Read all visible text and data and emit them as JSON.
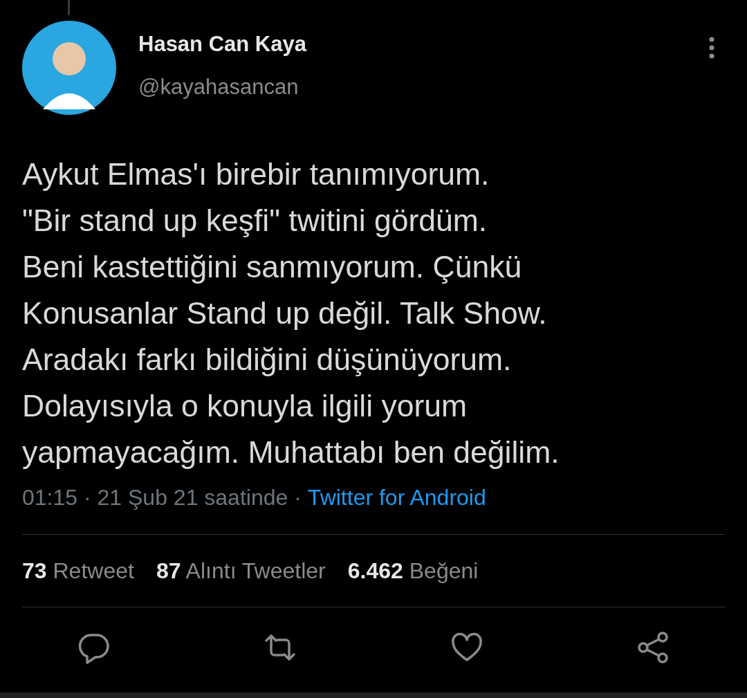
{
  "author": {
    "name": "Hasan Can Kaya",
    "handle": "@kayahasancan"
  },
  "tweet": {
    "text": "Aykut Elmas'ı birebir tanımıyorum.\n\"Bir stand up keşfi\" twitini gördüm.\nBeni kastettiğini sanmıyorum. Çünkü\nKonusanlar Stand up değil. Talk Show.\nAradakı farkı bildiğini düşünüyorum.\nDolayısıyla o konuyla ilgili yorum\nyapmayacağım. Muhattabı ben değilim.",
    "time": "01:15 · 21 Şub 21 saatinde ·",
    "source": "Twitter for Android"
  },
  "stats": [
    {
      "count": "73",
      "label": "Retweet"
    },
    {
      "count": "87",
      "label": "Alıntı Tweetler"
    },
    {
      "count": "6.462",
      "label": "Beğeni"
    }
  ],
  "actions": [
    {
      "kind": "reply"
    },
    {
      "kind": "retweet"
    },
    {
      "kind": "like"
    },
    {
      "kind": "share"
    }
  ]
}
